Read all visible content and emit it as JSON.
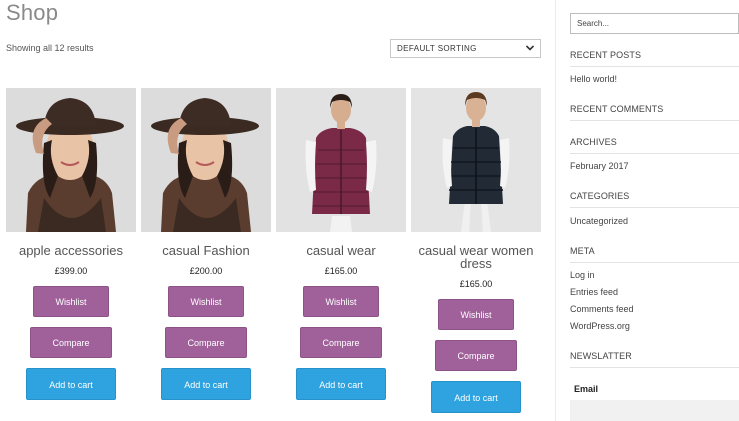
{
  "page": {
    "title": "Shop",
    "result_count": "Showing all 12 results"
  },
  "sorting": {
    "selected": "DEFAULT SORTING"
  },
  "products": [
    {
      "name": "apple accessories",
      "price": "£399.00",
      "wishlist": "Wishlist",
      "compare": "Compare",
      "cart": "Add to cart"
    },
    {
      "name": "casual Fashion",
      "price": "£200.00",
      "wishlist": "Wishlist",
      "compare": "Compare",
      "cart": "Add to cart"
    },
    {
      "name": "casual wear",
      "price": "£165.00",
      "wishlist": "Wishlist",
      "compare": "Compare",
      "cart": "Add to cart"
    },
    {
      "name": "casual wear women dress",
      "price": "£165.00",
      "wishlist": "Wishlist",
      "compare": "Compare",
      "cart": "Add to cart"
    }
  ],
  "sidebar": {
    "search_placeholder": "Search...",
    "recent_posts": {
      "title": "RECENT POSTS",
      "items": [
        "Hello world!"
      ]
    },
    "recent_comments": {
      "title": "RECENT COMMENTS"
    },
    "archives": {
      "title": "ARCHIVES",
      "items": [
        "February 2017"
      ]
    },
    "categories": {
      "title": "CATEGORIES",
      "items": [
        "Uncategorized"
      ]
    },
    "meta": {
      "title": "META",
      "items": [
        "Log in",
        "Entries feed",
        "Comments feed",
        "WordPress.org"
      ]
    },
    "newsletter": {
      "title": "NEWSLATTER",
      "email_label": "Email"
    }
  },
  "colors": {
    "button_purple": "#a0619a",
    "button_blue": "#2ea3e0",
    "title_gray": "#8a8a8a"
  }
}
